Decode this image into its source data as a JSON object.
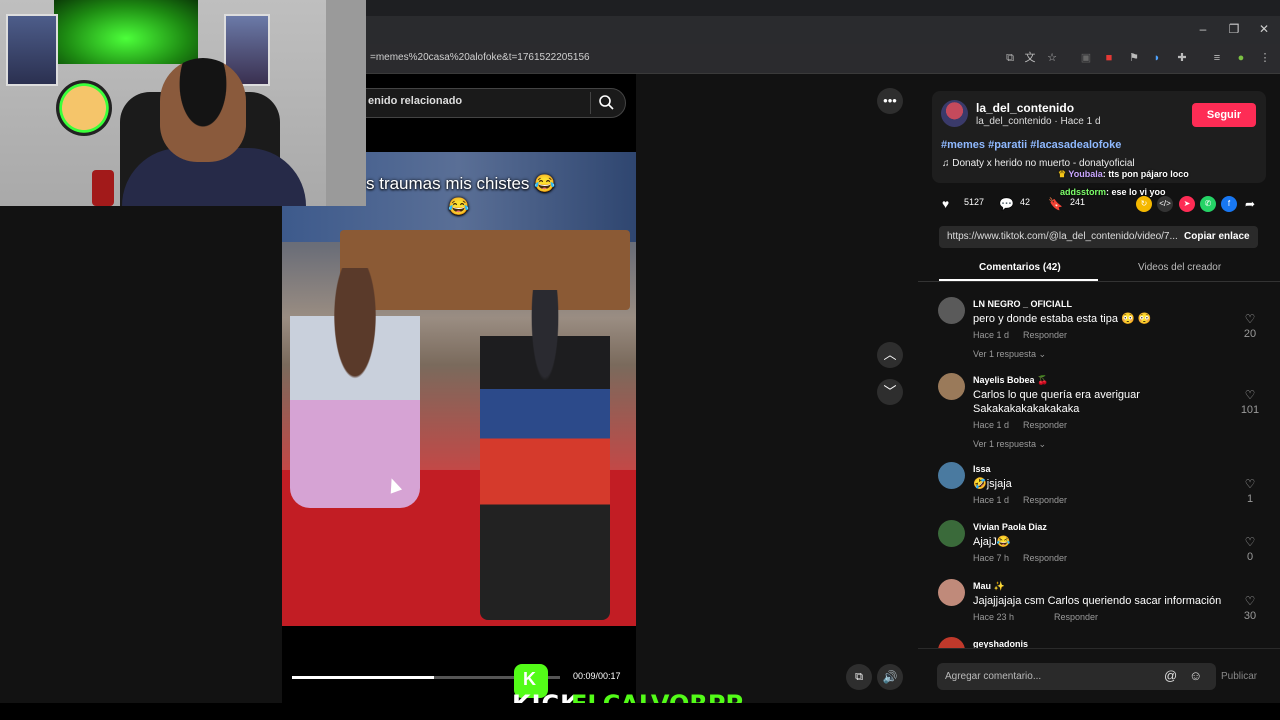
{
  "browser": {
    "url": "=memes%20casa%20alofoke&t=1761522205156",
    "window_controls": [
      "–",
      "❐",
      "✕"
    ]
  },
  "search": {
    "text": "enido relacionado"
  },
  "video": {
    "caption": "s traumas mis chistes 😂",
    "caption_line2": "😂",
    "progress_fraction": 0.53,
    "time": "00:09/00:17"
  },
  "overlay": {
    "kick_label": "KICK",
    "kick_user": "ELCALVORPP",
    "kick_k": "K"
  },
  "author": {
    "username": "la_del_contenido",
    "submeta": "la_del_contenido · Hace 1 d",
    "follow_label": "Seguir",
    "hashtags": "#memes #paratii #lacasadealofoke",
    "music": "♫  Donaty x herido no muerto - donatyoficial"
  },
  "chat": [
    {
      "user": "Youbala",
      "text": ": tts pon pájaro loco",
      "color": "#c9a6ff"
    },
    {
      "user": "addsstorm",
      "text": ": ese lo vi yoo",
      "color": "#7dff6a"
    }
  ],
  "stats": {
    "likes": "5127",
    "comments": "42",
    "saves": "241"
  },
  "share": {
    "link": "https://www.tiktok.com/@la_del_contenido/video/7...",
    "copy_label": "Copiar enlace"
  },
  "tabs": {
    "comments": "Comentarios (42)",
    "creator": "Videos del creador"
  },
  "comments": [
    {
      "name": "LN NEGRO _ OFICIALL",
      "text": "pero y donde estaba esta tipa 😳 😳",
      "text2": "",
      "time": "Hace 1 d",
      "reply": "Responder",
      "more": "Ver 1 respuesta ⌄",
      "likes": "20",
      "avatar": "#5a5a5a"
    },
    {
      "name": "Nayelis Bobea 🍒",
      "text": "Carlos lo que quería era averiguar",
      "text2": "Sakakakakakakakaka",
      "time": "Hace 1 d",
      "reply": "Responder",
      "more": "Ver 1 respuesta ⌄",
      "likes": "101",
      "avatar": "#9a7a5a"
    },
    {
      "name": "Issa",
      "text": "🤣jsjaja",
      "text2": "",
      "time": "Hace 1 d",
      "reply": "Responder",
      "more": "",
      "likes": "1",
      "avatar": "#4a7aa0"
    },
    {
      "name": "Vivian Paola Diaz",
      "text": "AjajJ😂",
      "text2": "",
      "time": "Hace 7 h",
      "reply": "Responder",
      "more": "",
      "likes": "0",
      "avatar": "#3a6a3a"
    },
    {
      "name": "Mau ✨",
      "text": "Jajajjajaja csm Carlos queriendo sacar información",
      "text2": "",
      "time": "Hace 23 h",
      "reply": "Responder",
      "more": "",
      "likes": "30",
      "avatar": "#c08a7a"
    },
    {
      "name": "geyshadonis",
      "text": "",
      "text2": "",
      "time": "",
      "reply": "",
      "more": "",
      "likes": "",
      "avatar": "#c0392b"
    }
  ],
  "composer": {
    "placeholder": "Agregar comentario...",
    "publish": "Publicar"
  },
  "icons": {
    "more": "more-options-icon",
    "up": "chevron-up-icon",
    "down": "chevron-down-icon",
    "volume": "volume-icon",
    "pip": "picture-in-picture-icon"
  }
}
